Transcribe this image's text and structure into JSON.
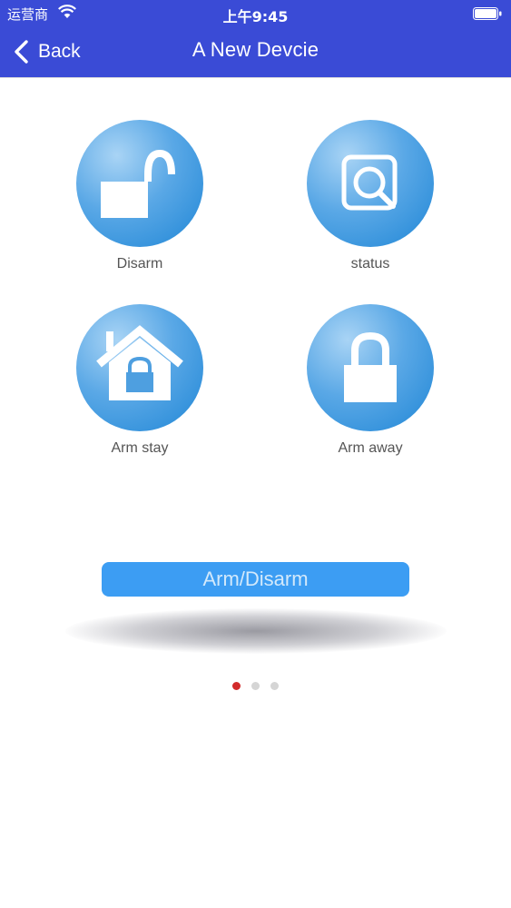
{
  "status_bar": {
    "carrier": "运营商",
    "time": "上午9:45",
    "wifi_icon": "wifi-icon",
    "battery_icon": "battery-icon"
  },
  "nav": {
    "back_label": "Back",
    "title": "A New Devcie"
  },
  "actions": [
    {
      "label": "Disarm",
      "icon": "unlock-icon"
    },
    {
      "label": "status",
      "icon": "search-status-icon"
    },
    {
      "label": "Arm stay",
      "icon": "home-lock-icon"
    },
    {
      "label": "Arm away",
      "icon": "lock-icon"
    }
  ],
  "main_button": {
    "label": "Arm/Disarm"
  },
  "pager": {
    "count": 3,
    "active_index": 0
  },
  "colors": {
    "nav_bg": "#3a4bd6",
    "circle_blue": "#1f86d6",
    "button_blue": "#3c9df3",
    "dot_active": "#d22b2b",
    "dot_inactive": "#d5d5d5"
  }
}
